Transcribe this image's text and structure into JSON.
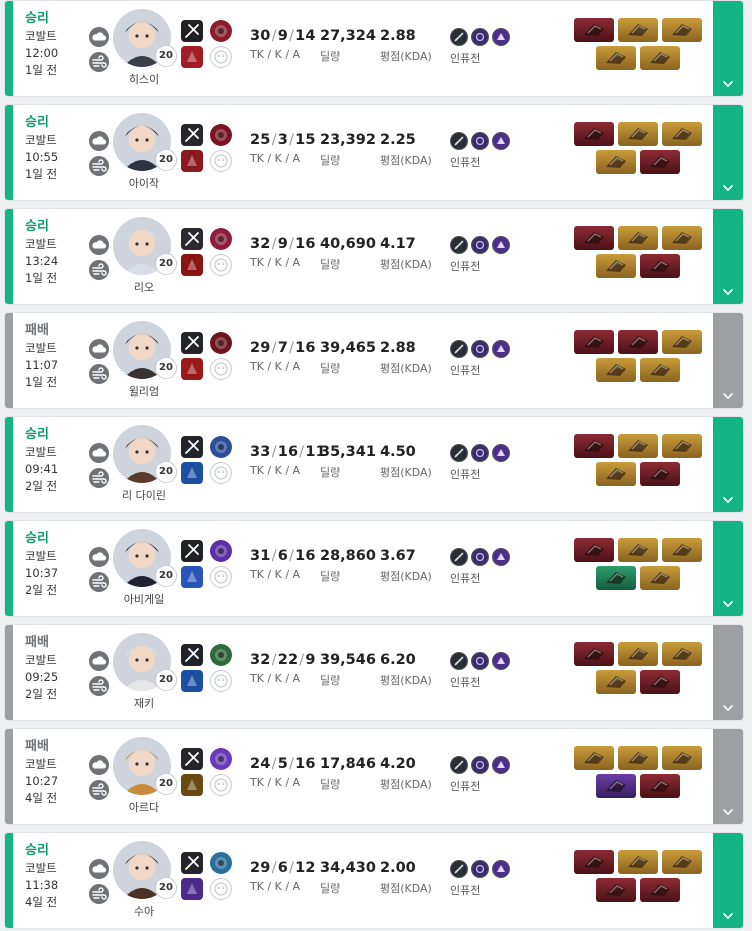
{
  "colors": {
    "win": "#13b584",
    "win_text": "#0f9b72",
    "loss": "#9d9fa3",
    "loss_text": "#6f7277",
    "item_red": "#8e2a33",
    "item_gold": "#c99b3a",
    "item_purple": "#6a3fa6",
    "item_blue": "#2c6fb5",
    "item_green": "#2e9e6e"
  },
  "labels": {
    "kda": "TK / K / A",
    "damage": "딜량",
    "rating": "평점(KDA)",
    "mode": "인퓨전"
  },
  "matches": [
    {
      "result": "승리",
      "map": "코발트",
      "time": "12:00",
      "ago": "1일 전",
      "character": "히스이",
      "level": "20",
      "kills": "30",
      "deaths": "9",
      "assists": "14",
      "damage": "27,324",
      "kda": "2.88",
      "items": [
        "red",
        "gold",
        "gold",
        "gold",
        "gold"
      ]
    },
    {
      "result": "승리",
      "map": "코발트",
      "time": "10:55",
      "ago": "1일 전",
      "character": "아이작",
      "level": "20",
      "kills": "25",
      "deaths": "3",
      "assists": "15",
      "damage": "23,392",
      "kda": "2.25",
      "items": [
        "red",
        "gold",
        "gold",
        "gold",
        "red"
      ]
    },
    {
      "result": "승리",
      "map": "코발트",
      "time": "13:24",
      "ago": "1일 전",
      "character": "리오",
      "level": "20",
      "kills": "32",
      "deaths": "9",
      "assists": "16",
      "damage": "40,690",
      "kda": "4.17",
      "items": [
        "red",
        "gold",
        "gold",
        "gold",
        "red"
      ]
    },
    {
      "result": "패배",
      "map": "코발트",
      "time": "11:07",
      "ago": "1일 전",
      "character": "윌리엄",
      "level": "20",
      "kills": "29",
      "deaths": "7",
      "assists": "16",
      "damage": "39,465",
      "kda": "2.88",
      "items": [
        "red",
        "red",
        "gold",
        "gold",
        "gold"
      ]
    },
    {
      "result": "승리",
      "map": "코발트",
      "time": "09:41",
      "ago": "2일 전",
      "character": "리 다이린",
      "level": "20",
      "kills": "33",
      "deaths": "16",
      "assists": "11",
      "damage": "35,341",
      "kda": "4.50",
      "items": [
        "red",
        "gold",
        "gold",
        "gold",
        "red"
      ]
    },
    {
      "result": "승리",
      "map": "코발트",
      "time": "10:37",
      "ago": "2일 전",
      "character": "아비게일",
      "level": "20",
      "kills": "31",
      "deaths": "6",
      "assists": "16",
      "damage": "28,860",
      "kda": "3.67",
      "items": [
        "red",
        "gold",
        "gold",
        "green",
        "gold"
      ]
    },
    {
      "result": "패배",
      "map": "코발트",
      "time": "09:25",
      "ago": "2일 전",
      "character": "재키",
      "level": "20",
      "kills": "32",
      "deaths": "22",
      "assists": "9",
      "damage": "39,546",
      "kda": "6.20",
      "items": [
        "red",
        "gold",
        "gold",
        "gold",
        "red"
      ]
    },
    {
      "result": "패배",
      "map": "코발트",
      "time": "10:27",
      "ago": "4일 전",
      "character": "아르다",
      "level": "20",
      "kills": "24",
      "deaths": "5",
      "assists": "16",
      "damage": "17,846",
      "kda": "4.20",
      "items": [
        "gold",
        "gold",
        "gold",
        "purple",
        "red"
      ]
    },
    {
      "result": "승리",
      "map": "코발트",
      "time": "11:38",
      "ago": "4일 전",
      "character": "수아",
      "level": "20",
      "kills": "29",
      "deaths": "6",
      "assists": "12",
      "damage": "34,430",
      "kda": "2.00",
      "items": [
        "red",
        "gold",
        "gold",
        "red",
        "red"
      ]
    }
  ]
}
